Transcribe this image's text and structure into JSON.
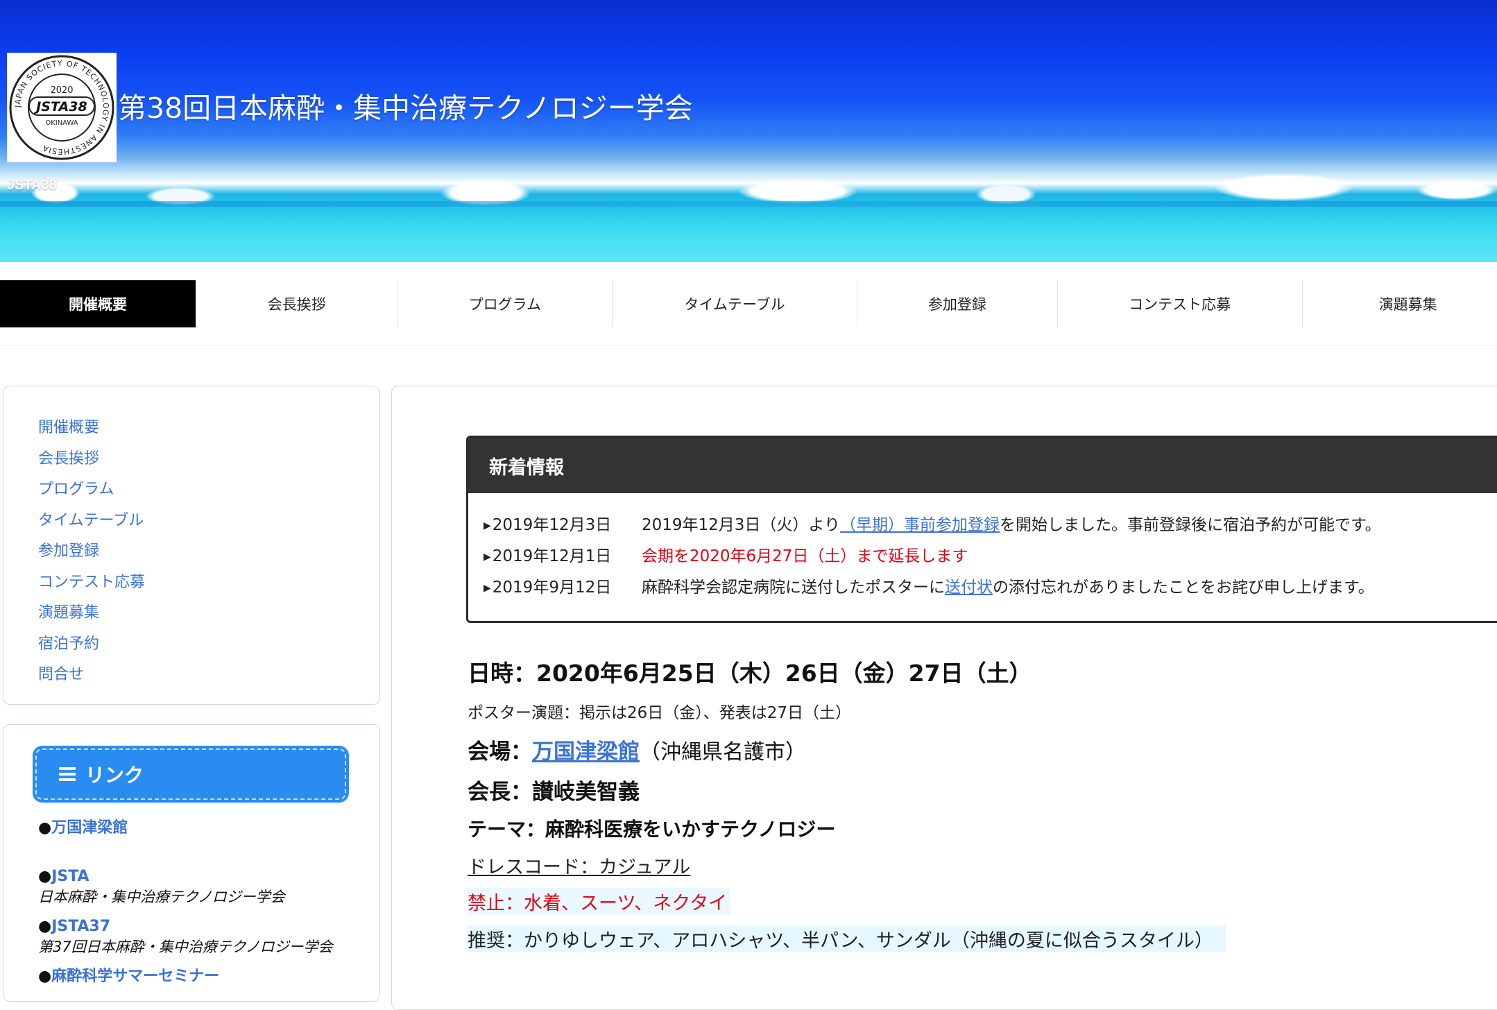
{
  "header": {
    "title": "第38回日本麻酔・集中治療テクノロジー学会",
    "subtitle": "JSTA38",
    "logo": {
      "year": "2020",
      "code": "JSTA38",
      "place": "OKINAWA",
      "ring_text": "JAPAN SOCIETY OF TECHNOLOGY IN ANESTHESIA"
    }
  },
  "nav": {
    "items": [
      {
        "label": "開催概要"
      },
      {
        "label": "会長挨拶"
      },
      {
        "label": "プログラム"
      },
      {
        "label": "タイムテーブル"
      },
      {
        "label": "参加登録"
      },
      {
        "label": "コンテスト応募"
      },
      {
        "label": "演題募集"
      }
    ],
    "active_index": 0
  },
  "sidebar": {
    "menu": [
      {
        "label": "開催概要"
      },
      {
        "label": "会長挨拶"
      },
      {
        "label": "プログラム"
      },
      {
        "label": "タイムテーブル"
      },
      {
        "label": "参加登録"
      },
      {
        "label": "コンテスト応募"
      },
      {
        "label": "演題募集"
      },
      {
        "label": "宿泊予約"
      },
      {
        "label": "問合せ"
      }
    ],
    "links_title": "リンク",
    "links": [
      {
        "bullet": "●",
        "label": "万国津梁館",
        "desc": ""
      },
      {
        "bullet": "●",
        "label": "JSTA",
        "desc": "日本麻酔・集中治療テクノロジー学会"
      },
      {
        "bullet": "●",
        "label": "JSTA37",
        "desc": "第37回日本麻酔・集中治療テクノロジー学会"
      },
      {
        "bullet": "●",
        "label": "麻酔科学サマーセミナー",
        "desc": ""
      }
    ]
  },
  "news": {
    "title": "新着情報",
    "items": [
      {
        "date": "2019年12月3日",
        "pre": "2019年12月3日（火）より",
        "link": "（早期）事前参加登録",
        "post": "を開始しました。事前登録後に宿泊予約が可能です。"
      },
      {
        "date": "2019年12月1日",
        "text": "会期を2020年6月27日（土）まで延長します"
      },
      {
        "date": "2019年9月12日",
        "pre": "麻酔科学会認定病院に送付したポスターに",
        "link": "送付状",
        "post": "の添付忘れがありましたことをお詫び申し上げます。"
      }
    ]
  },
  "details": {
    "date": "日時：2020年6月25日（木）26日（金）27日（土）",
    "poster": "ポスター演題：掲示は26日（金）、発表は27日（土）",
    "venue_label": "会場：",
    "venue_link": "万国津梁館",
    "venue_location": "（沖縄県名護市）",
    "chair": "会長：讃岐美智義",
    "theme": "テーマ：麻酔科医療をいかすテクノロジー",
    "dress_code": "ドレスコード：カジュアル",
    "banned": "禁止：水着、スーツ、ネクタイ",
    "recommended": "推奨：かりゆしウェア、アロハシャツ、半パン、サンダル（沖縄の夏に似合うスタイル）"
  },
  "colors": {
    "link": "#3a72d8",
    "alert": "#e60012",
    "nav_active_bg": "#000000",
    "link_header_bg": "#2a8cf0"
  }
}
